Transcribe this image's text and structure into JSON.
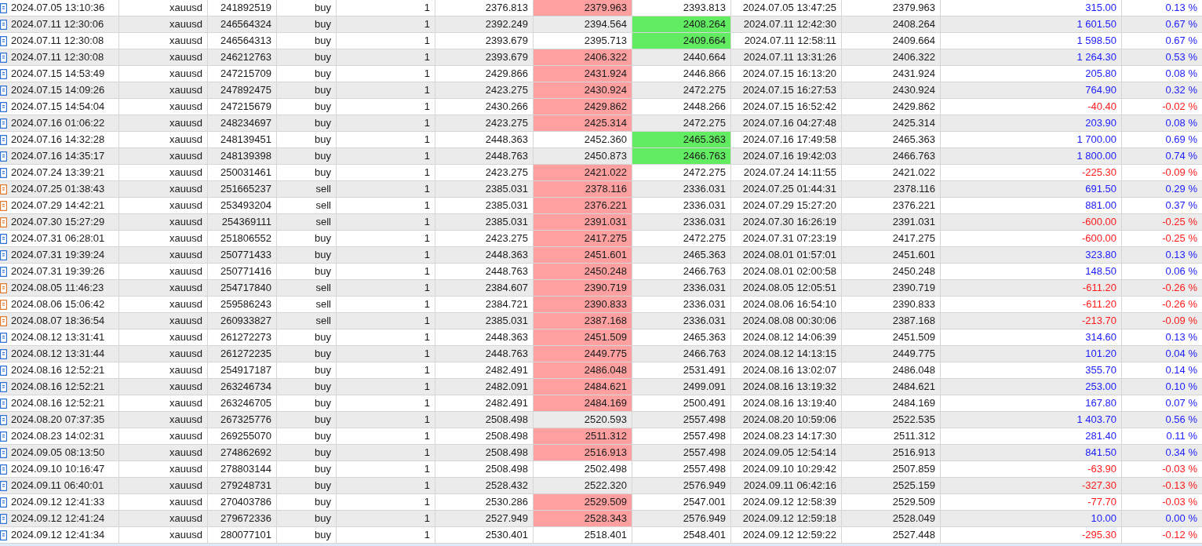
{
  "rows": [
    {
      "kind": "buy",
      "open_time": "2024.07.05 13:10:36",
      "symbol": "xauusd",
      "ticket": "241892519",
      "type": "buy",
      "volume": "1",
      "price": "2376.813",
      "sl": "2379.963",
      "sl_hit": true,
      "tp": "2393.813",
      "tp_hit": false,
      "close_time": "2024.07.05 13:47:25",
      "close_price": "2379.963",
      "profit": "315.00",
      "change": "0.13 %",
      "color": "#2020ff"
    },
    {
      "kind": "buy",
      "open_time": "2024.07.11 12:30:06",
      "symbol": "xauusd",
      "ticket": "246564324",
      "type": "buy",
      "volume": "1",
      "price": "2392.249",
      "sl": "2394.564",
      "sl_hit": false,
      "tp": "2408.264",
      "tp_hit": true,
      "close_time": "2024.07.11 12:42:30",
      "close_price": "2408.264",
      "profit": "1 601.50",
      "change": "0.67 %",
      "color": "#2020ff"
    },
    {
      "kind": "buy",
      "open_time": "2024.07.11 12:30:08",
      "symbol": "xauusd",
      "ticket": "246564313",
      "type": "buy",
      "volume": "1",
      "price": "2393.679",
      "sl": "2395.713",
      "sl_hit": false,
      "tp": "2409.664",
      "tp_hit": true,
      "close_time": "2024.07.11 12:58:11",
      "close_price": "2409.664",
      "profit": "1 598.50",
      "change": "0.67 %",
      "color": "#2020ff"
    },
    {
      "kind": "buy",
      "open_time": "2024.07.11 12:30:08",
      "symbol": "xauusd",
      "ticket": "246212763",
      "type": "buy",
      "volume": "1",
      "price": "2393.679",
      "sl": "2406.322",
      "sl_hit": true,
      "tp": "2440.664",
      "tp_hit": false,
      "close_time": "2024.07.11 13:31:26",
      "close_price": "2406.322",
      "profit": "1 264.30",
      "change": "0.53 %",
      "color": "#2020ff"
    },
    {
      "kind": "buy",
      "open_time": "2024.07.15 14:53:49",
      "symbol": "xauusd",
      "ticket": "247215709",
      "type": "buy",
      "volume": "1",
      "price": "2429.866",
      "sl": "2431.924",
      "sl_hit": true,
      "tp": "2446.866",
      "tp_hit": false,
      "close_time": "2024.07.15 16:13:20",
      "close_price": "2431.924",
      "profit": "205.80",
      "change": "0.08 %",
      "color": "#2020ff"
    },
    {
      "kind": "buy",
      "open_time": "2024.07.15 14:09:26",
      "symbol": "xauusd",
      "ticket": "247892475",
      "type": "buy",
      "volume": "1",
      "price": "2423.275",
      "sl": "2430.924",
      "sl_hit": true,
      "tp": "2472.275",
      "tp_hit": false,
      "close_time": "2024.07.15 16:27:53",
      "close_price": "2430.924",
      "profit": "764.90",
      "change": "0.32 %",
      "color": "#2020ff"
    },
    {
      "kind": "buy",
      "open_time": "2024.07.15 14:54:04",
      "symbol": "xauusd",
      "ticket": "247215679",
      "type": "buy",
      "volume": "1",
      "price": "2430.266",
      "sl": "2429.862",
      "sl_hit": true,
      "tp": "2448.266",
      "tp_hit": false,
      "close_time": "2024.07.15 16:52:42",
      "close_price": "2429.862",
      "profit": "-40.40",
      "change": "-0.02 %",
      "color": "#ff1a1a"
    },
    {
      "kind": "buy",
      "open_time": "2024.07.16 01:06:22",
      "symbol": "xauusd",
      "ticket": "248234697",
      "type": "buy",
      "volume": "1",
      "price": "2423.275",
      "sl": "2425.314",
      "sl_hit": true,
      "tp": "2472.275",
      "tp_hit": false,
      "close_time": "2024.07.16 04:27:48",
      "close_price": "2425.314",
      "profit": "203.90",
      "change": "0.08 %",
      "color": "#2020ff"
    },
    {
      "kind": "buy",
      "open_time": "2024.07.16 14:32:28",
      "symbol": "xauusd",
      "ticket": "248139451",
      "type": "buy",
      "volume": "1",
      "price": "2448.363",
      "sl": "2452.360",
      "sl_hit": false,
      "tp": "2465.363",
      "tp_hit": true,
      "close_time": "2024.07.16 17:49:58",
      "close_price": "2465.363",
      "profit": "1 700.00",
      "change": "0.69 %",
      "color": "#2020ff"
    },
    {
      "kind": "buy",
      "open_time": "2024.07.16 14:35:17",
      "symbol": "xauusd",
      "ticket": "248139398",
      "type": "buy",
      "volume": "1",
      "price": "2448.763",
      "sl": "2450.873",
      "sl_hit": false,
      "tp": "2466.763",
      "tp_hit": true,
      "close_time": "2024.07.16 19:42:03",
      "close_price": "2466.763",
      "profit": "1 800.00",
      "change": "0.74 %",
      "color": "#2020ff"
    },
    {
      "kind": "buy",
      "open_time": "2024.07.24 13:39:21",
      "symbol": "xauusd",
      "ticket": "250031461",
      "type": "buy",
      "volume": "1",
      "price": "2423.275",
      "sl": "2421.022",
      "sl_hit": true,
      "tp": "2472.275",
      "tp_hit": false,
      "close_time": "2024.07.24 14:11:55",
      "close_price": "2421.022",
      "profit": "-225.30",
      "change": "-0.09 %",
      "color": "#ff1a1a"
    },
    {
      "kind": "sell",
      "open_time": "2024.07.25 01:38:43",
      "symbol": "xauusd",
      "ticket": "251665237",
      "type": "sell",
      "volume": "1",
      "price": "2385.031",
      "sl": "2378.116",
      "sl_hit": true,
      "tp": "2336.031",
      "tp_hit": false,
      "close_time": "2024.07.25 01:44:31",
      "close_price": "2378.116",
      "profit": "691.50",
      "change": "0.29 %",
      "color": "#2020ff"
    },
    {
      "kind": "sell",
      "open_time": "2024.07.29 14:42:21",
      "symbol": "xauusd",
      "ticket": "253493204",
      "type": "sell",
      "volume": "1",
      "price": "2385.031",
      "sl": "2376.221",
      "sl_hit": true,
      "tp": "2336.031",
      "tp_hit": false,
      "close_time": "2024.07.29 15:27:20",
      "close_price": "2376.221",
      "profit": "881.00",
      "change": "0.37 %",
      "color": "#2020ff"
    },
    {
      "kind": "sell",
      "open_time": "2024.07.30 15:27:29",
      "symbol": "xauusd",
      "ticket": "254369111",
      "type": "sell",
      "volume": "1",
      "price": "2385.031",
      "sl": "2391.031",
      "sl_hit": true,
      "tp": "2336.031",
      "tp_hit": false,
      "close_time": "2024.07.30 16:26:19",
      "close_price": "2391.031",
      "profit": "-600.00",
      "change": "-0.25 %",
      "color": "#ff1a1a"
    },
    {
      "kind": "buy",
      "open_time": "2024.07.31 06:28:01",
      "symbol": "xauusd",
      "ticket": "251806552",
      "type": "buy",
      "volume": "1",
      "price": "2423.275",
      "sl": "2417.275",
      "sl_hit": true,
      "tp": "2472.275",
      "tp_hit": false,
      "close_time": "2024.07.31 07:23:19",
      "close_price": "2417.275",
      "profit": "-600.00",
      "change": "-0.25 %",
      "color": "#ff1a1a"
    },
    {
      "kind": "buy",
      "open_time": "2024.07.31 19:39:24",
      "symbol": "xauusd",
      "ticket": "250771433",
      "type": "buy",
      "volume": "1",
      "price": "2448.363",
      "sl": "2451.601",
      "sl_hit": true,
      "tp": "2465.363",
      "tp_hit": false,
      "close_time": "2024.08.01 01:57:01",
      "close_price": "2451.601",
      "profit": "323.80",
      "change": "0.13 %",
      "color": "#2020ff"
    },
    {
      "kind": "buy",
      "open_time": "2024.07.31 19:39:26",
      "symbol": "xauusd",
      "ticket": "250771416",
      "type": "buy",
      "volume": "1",
      "price": "2448.763",
      "sl": "2450.248",
      "sl_hit": true,
      "tp": "2466.763",
      "tp_hit": false,
      "close_time": "2024.08.01 02:00:58",
      "close_price": "2450.248",
      "profit": "148.50",
      "change": "0.06 %",
      "color": "#2020ff"
    },
    {
      "kind": "sell",
      "open_time": "2024.08.05 11:46:23",
      "symbol": "xauusd",
      "ticket": "254717840",
      "type": "sell",
      "volume": "1",
      "price": "2384.607",
      "sl": "2390.719",
      "sl_hit": true,
      "tp": "2336.031",
      "tp_hit": false,
      "close_time": "2024.08.05 12:05:51",
      "close_price": "2390.719",
      "profit": "-611.20",
      "change": "-0.26 %",
      "color": "#ff1a1a"
    },
    {
      "kind": "sell",
      "open_time": "2024.08.06 15:06:42",
      "symbol": "xauusd",
      "ticket": "259586243",
      "type": "sell",
      "volume": "1",
      "price": "2384.721",
      "sl": "2390.833",
      "sl_hit": true,
      "tp": "2336.031",
      "tp_hit": false,
      "close_time": "2024.08.06 16:54:10",
      "close_price": "2390.833",
      "profit": "-611.20",
      "change": "-0.26 %",
      "color": "#ff1a1a"
    },
    {
      "kind": "sell",
      "open_time": "2024.08.07 18:36:54",
      "symbol": "xauusd",
      "ticket": "260933827",
      "type": "sell",
      "volume": "1",
      "price": "2385.031",
      "sl": "2387.168",
      "sl_hit": true,
      "tp": "2336.031",
      "tp_hit": false,
      "close_time": "2024.08.08 00:30:06",
      "close_price": "2387.168",
      "profit": "-213.70",
      "change": "-0.09 %",
      "color": "#ff1a1a"
    },
    {
      "kind": "buy",
      "open_time": "2024.08.12 13:31:41",
      "symbol": "xauusd",
      "ticket": "261272273",
      "type": "buy",
      "volume": "1",
      "price": "2448.363",
      "sl": "2451.509",
      "sl_hit": true,
      "tp": "2465.363",
      "tp_hit": false,
      "close_time": "2024.08.12 14:06:39",
      "close_price": "2451.509",
      "profit": "314.60",
      "change": "0.13 %",
      "color": "#2020ff"
    },
    {
      "kind": "buy",
      "open_time": "2024.08.12 13:31:44",
      "symbol": "xauusd",
      "ticket": "261272235",
      "type": "buy",
      "volume": "1",
      "price": "2448.763",
      "sl": "2449.775",
      "sl_hit": true,
      "tp": "2466.763",
      "tp_hit": false,
      "close_time": "2024.08.12 14:13:15",
      "close_price": "2449.775",
      "profit": "101.20",
      "change": "0.04 %",
      "color": "#2020ff"
    },
    {
      "kind": "buy",
      "open_time": "2024.08.16 12:52:21",
      "symbol": "xauusd",
      "ticket": "254917187",
      "type": "buy",
      "volume": "1",
      "price": "2482.491",
      "sl": "2486.048",
      "sl_hit": true,
      "tp": "2531.491",
      "tp_hit": false,
      "close_time": "2024.08.16 13:02:07",
      "close_price": "2486.048",
      "profit": "355.70",
      "change": "0.14 %",
      "color": "#2020ff"
    },
    {
      "kind": "buy",
      "open_time": "2024.08.16 12:52:21",
      "symbol": "xauusd",
      "ticket": "263246734",
      "type": "buy",
      "volume": "1",
      "price": "2482.091",
      "sl": "2484.621",
      "sl_hit": true,
      "tp": "2499.091",
      "tp_hit": false,
      "close_time": "2024.08.16 13:19:32",
      "close_price": "2484.621",
      "profit": "253.00",
      "change": "0.10 %",
      "color": "#2020ff"
    },
    {
      "kind": "buy",
      "open_time": "2024.08.16 12:52:21",
      "symbol": "xauusd",
      "ticket": "263246705",
      "type": "buy",
      "volume": "1",
      "price": "2482.491",
      "sl": "2484.169",
      "sl_hit": true,
      "tp": "2500.491",
      "tp_hit": false,
      "close_time": "2024.08.16 13:19:40",
      "close_price": "2484.169",
      "profit": "167.80",
      "change": "0.07 %",
      "color": "#2020ff"
    },
    {
      "kind": "buy",
      "open_time": "2024.08.20 07:37:35",
      "symbol": "xauusd",
      "ticket": "267325776",
      "type": "buy",
      "volume": "1",
      "price": "2508.498",
      "sl": "2520.593",
      "sl_hit": false,
      "tp": "2557.498",
      "tp_hit": false,
      "close_time": "2024.08.20 10:59:06",
      "close_price": "2522.535",
      "profit": "1 403.70",
      "change": "0.56 %",
      "color": "#2020ff"
    },
    {
      "kind": "buy",
      "open_time": "2024.08.23 14:02:31",
      "symbol": "xauusd",
      "ticket": "269255070",
      "type": "buy",
      "volume": "1",
      "price": "2508.498",
      "sl": "2511.312",
      "sl_hit": true,
      "tp": "2557.498",
      "tp_hit": false,
      "close_time": "2024.08.23 14:17:30",
      "close_price": "2511.312",
      "profit": "281.40",
      "change": "0.11 %",
      "color": "#2020ff"
    },
    {
      "kind": "buy",
      "open_time": "2024.09.05 08:13:50",
      "symbol": "xauusd",
      "ticket": "274862692",
      "type": "buy",
      "volume": "1",
      "price": "2508.498",
      "sl": "2516.913",
      "sl_hit": true,
      "tp": "2557.498",
      "tp_hit": false,
      "close_time": "2024.09.05 12:54:14",
      "close_price": "2516.913",
      "profit": "841.50",
      "change": "0.34 %",
      "color": "#2020ff"
    },
    {
      "kind": "buy",
      "open_time": "2024.09.10 10:16:47",
      "symbol": "xauusd",
      "ticket": "278803144",
      "type": "buy",
      "volume": "1",
      "price": "2508.498",
      "sl": "2502.498",
      "sl_hit": false,
      "tp": "2557.498",
      "tp_hit": false,
      "close_time": "2024.09.10 10:29:42",
      "close_price": "2507.859",
      "profit": "-63.90",
      "change": "-0.03 %",
      "color": "#ff1a1a"
    },
    {
      "kind": "buy",
      "open_time": "2024.09.11 06:40:01",
      "symbol": "xauusd",
      "ticket": "279248731",
      "type": "buy",
      "volume": "1",
      "price": "2528.432",
      "sl": "2522.320",
      "sl_hit": false,
      "tp": "2576.949",
      "tp_hit": false,
      "close_time": "2024.09.11 06:42:16",
      "close_price": "2525.159",
      "profit": "-327.30",
      "change": "-0.13 %",
      "color": "#ff1a1a"
    },
    {
      "kind": "buy",
      "open_time": "2024.09.12 12:41:33",
      "symbol": "xauusd",
      "ticket": "270403786",
      "type": "buy",
      "volume": "1",
      "price": "2530.286",
      "sl": "2529.509",
      "sl_hit": true,
      "tp": "2547.001",
      "tp_hit": false,
      "close_time": "2024.09.12 12:58:39",
      "close_price": "2529.509",
      "profit": "-77.70",
      "change": "-0.03 %",
      "color": "#ff1a1a"
    },
    {
      "kind": "buy",
      "open_time": "2024.09.12 12:41:24",
      "symbol": "xauusd",
      "ticket": "279672336",
      "type": "buy",
      "volume": "1",
      "price": "2527.949",
      "sl": "2528.343",
      "sl_hit": true,
      "tp": "2576.949",
      "tp_hit": false,
      "close_time": "2024.09.12 12:59:18",
      "close_price": "2528.049",
      "profit": "10.00",
      "change": "0.00 %",
      "color": "#2020ff"
    },
    {
      "kind": "buy",
      "open_time": "2024.09.12 12:41:34",
      "symbol": "xauusd",
      "ticket": "280077101",
      "type": "buy",
      "volume": "1",
      "price": "2530.401",
      "sl": "2518.401",
      "sl_hit": false,
      "tp": "2548.401",
      "tp_hit": false,
      "close_time": "2024.09.12 12:59:22",
      "close_price": "2527.448",
      "profit": "-295.30",
      "change": "-0.12 %",
      "color": "#ff1a1a"
    }
  ]
}
